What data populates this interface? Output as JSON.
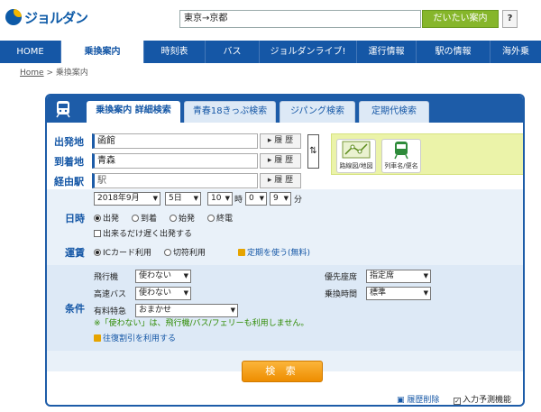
{
  "header": {
    "logo_text": "ジョルダン",
    "search_value": "東京→京都",
    "search_button": "だいたい案内",
    "help_label": "?"
  },
  "nav": {
    "items": [
      "HOME",
      "乗換案内",
      "時刻表",
      "バス",
      "ジョルダンライブ!",
      "運行情報",
      "駅の情報",
      "海外乗"
    ]
  },
  "breadcrumb": {
    "home": "Home",
    "sep": ">",
    "current": "乗換案内"
  },
  "tabs": [
    "乗換案内 詳細検索",
    "青春18きっぷ検索",
    "ジパング検索",
    "定期代検索"
  ],
  "stations": {
    "from_label": "出発地",
    "from_value": "函館",
    "to_label": "到着地",
    "to_value": "青森",
    "via_label": "経由駅",
    "via_value": "駅",
    "history_label": "履 歴",
    "swap_label": "⇅",
    "map_label": "路線図/地図",
    "train_label": "列車名/便名"
  },
  "datetime": {
    "label": "日時",
    "year_month": "2018年9月",
    "day": "5日",
    "hour": "10",
    "hour_unit": "時",
    "minute_tens": "0",
    "minute_ones": "9",
    "minute_unit": "分",
    "options": [
      "出発",
      "到着",
      "始発",
      "終電"
    ],
    "selected": "出発",
    "late_departure": "出来るだけ遅く出発する"
  },
  "fare": {
    "label": "運賃",
    "options": [
      "ICカード利用",
      "切符利用"
    ],
    "selected": "ICカード利用",
    "teiki_link": "定期を使う(無料)"
  },
  "conditions": {
    "label": "条件",
    "airplane_label": "飛行機",
    "airplane_value": "使わない",
    "highway_bus_label": "高速バス",
    "highway_bus_value": "使わない",
    "express_label": "有料特急",
    "express_value": "おまかせ",
    "seat_label": "優先座席",
    "seat_value": "指定席",
    "transfer_time_label": "乗換時間",
    "transfer_time_value": "標準",
    "note": "※「使わない」は、飛行機/バス/フェリーも利用しません。",
    "round_trip_link": "往復割引を利用する"
  },
  "actions": {
    "search_button": "検 索",
    "clear_history": "履歴削除",
    "predictive_input": "入力予測機能"
  }
}
